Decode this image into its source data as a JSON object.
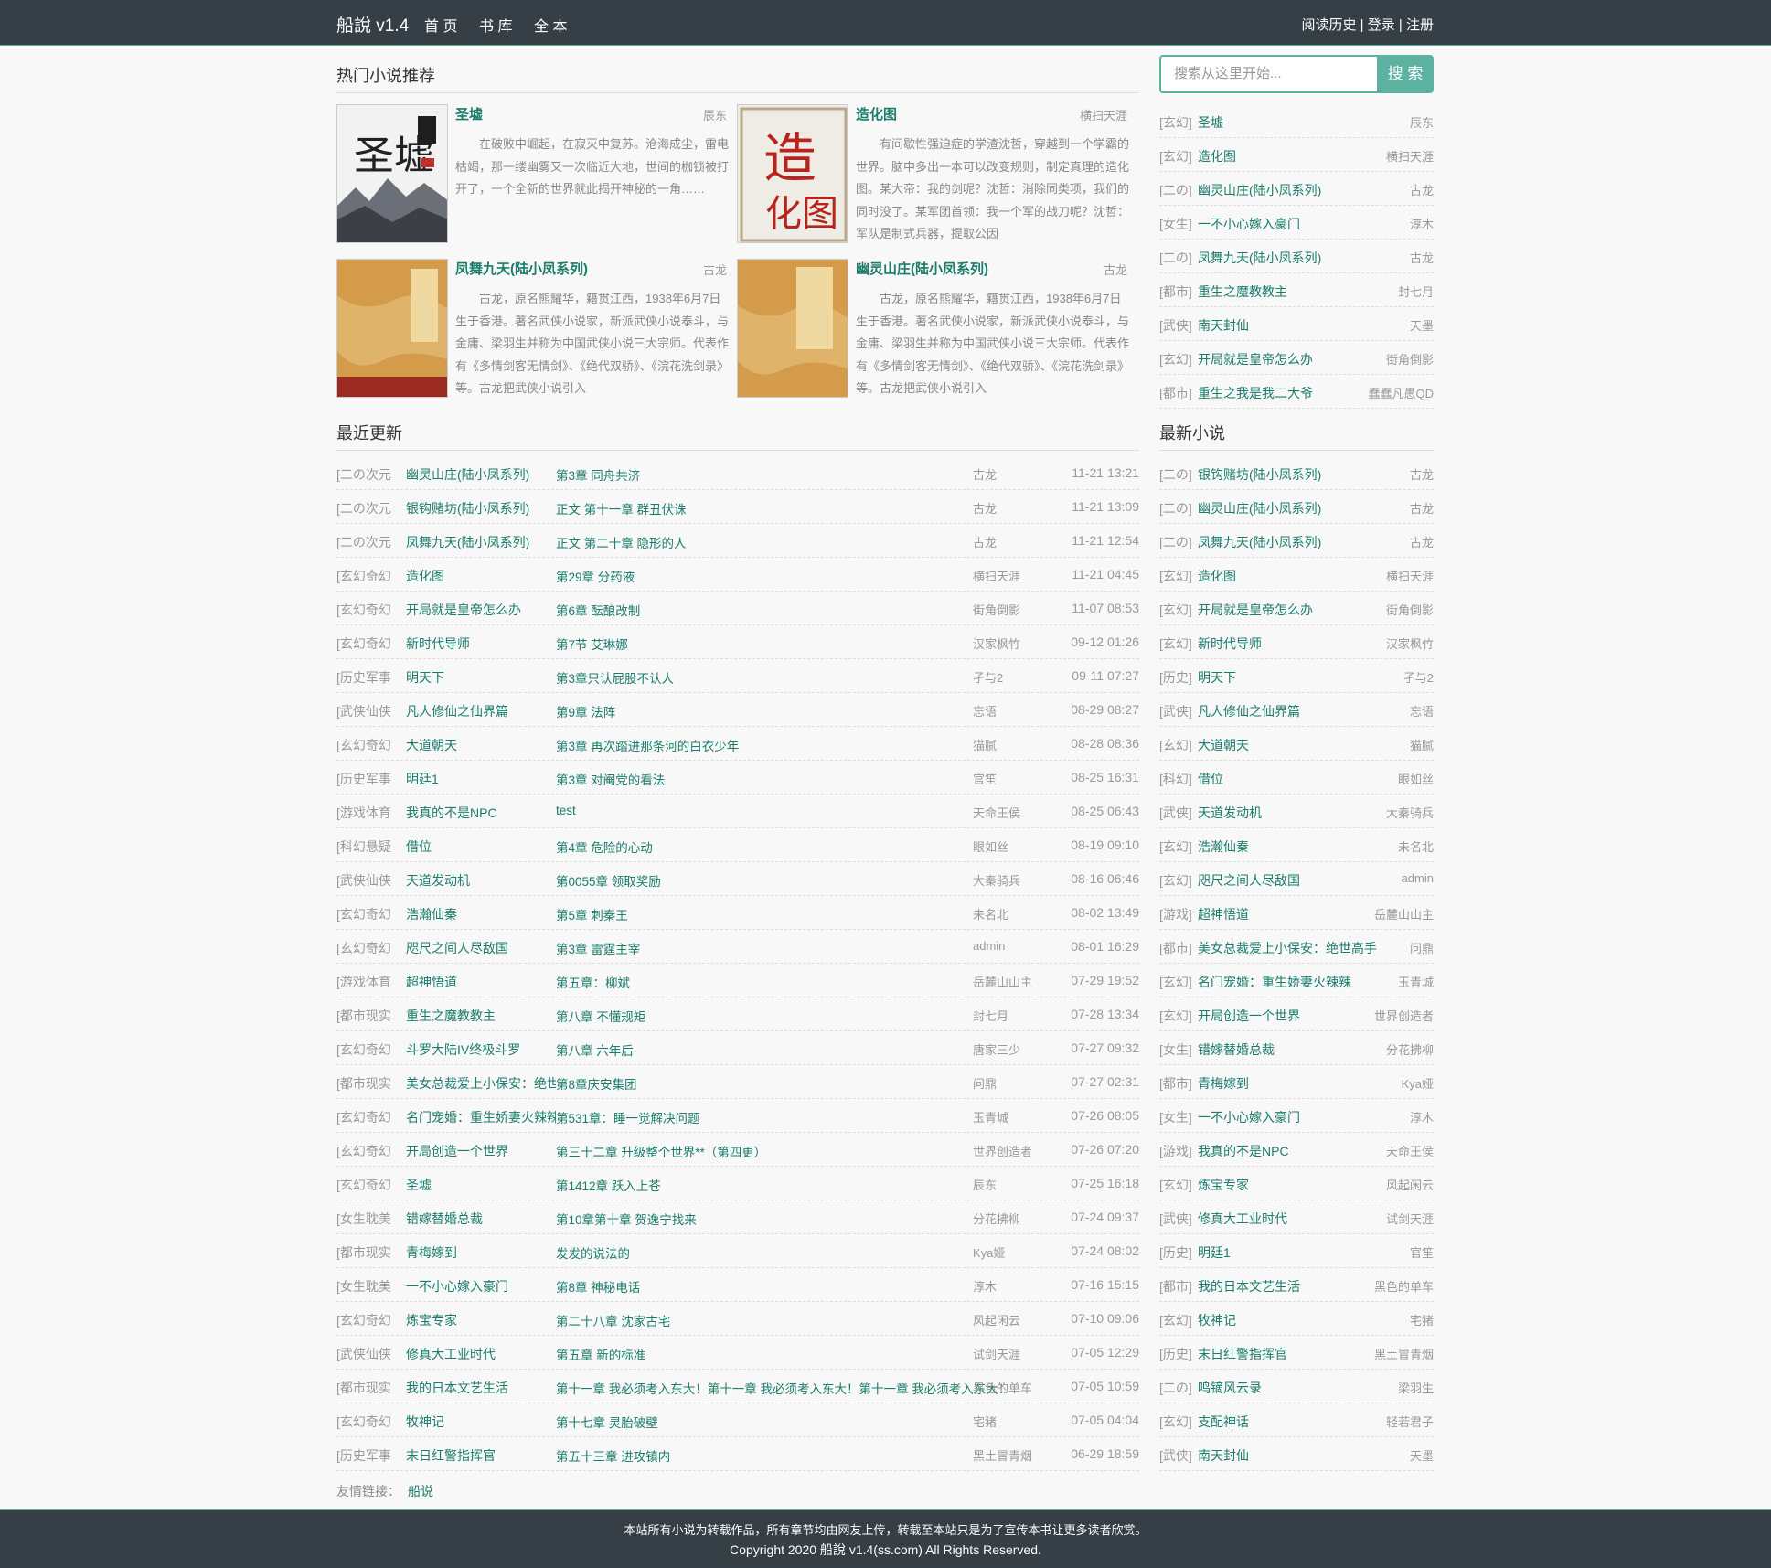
{
  "header": {
    "brand": "船說 v1.4",
    "nav": [
      "首 页",
      "书 库",
      "全 本"
    ],
    "links": [
      "阅读历史",
      "登录",
      "注册"
    ],
    "sep": "|"
  },
  "hot": {
    "title": "热门小说推荐",
    "books": [
      {
        "name": "圣墟",
        "author": "辰东",
        "desc": "在破败中崛起，在寂灭中复苏。沧海成尘，雷电枯竭，那一缕幽雾又一次临近大地，世间的枷锁被打开了，一个全新的世界就此揭开神秘的一角……"
      },
      {
        "name": "造化图",
        "author": "横扫天涯",
        "desc": "有间歇性强迫症的学渣沈哲，穿越到一个学霸的世界。脑中多出一本可以改变规则，制定真理的造化图。某大帝：我的剑呢？沈哲：消除同类项，我们的同时没了。某军团首领：我一个军的战刀呢？沈哲：军队是制式兵器，提取公因"
      },
      {
        "name": "凤舞九天(陆小凤系列)",
        "author": "古龙",
        "desc": "古龙，原名熊耀华，籍贯江西，1938年6月7日生于香港。著名武侠小说家，新派武侠小说泰斗，与金庸、梁羽生并称为中国武侠小说三大宗师。代表作有《多情剑客无情剑》、《绝代双骄》、《浣花洗剑录》等。古龙把武侠小说引入"
      },
      {
        "name": "幽灵山庄(陆小凤系列)",
        "author": "古龙",
        "desc": "古龙，原名熊耀华，籍贯江西，1938年6月7日生于香港。著名武侠小说家，新派武侠小说泰斗，与金庸、梁羽生并称为中国武侠小说三大宗师。代表作有《多情剑客无情剑》、《绝代双骄》、《浣花洗剑录》等。古龙把武侠小说引入"
      }
    ]
  },
  "recent": {
    "title": "最近更新",
    "rows": [
      {
        "cat": "[二の次元",
        "name": "幽灵山庄(陆小凤系列)",
        "chapter": "第3章 同舟共济",
        "author": "古龙",
        "time": "11-21 13:21"
      },
      {
        "cat": "[二の次元",
        "name": "银钩赌坊(陆小凤系列)",
        "chapter": "正文 第十一章 群丑伏诛",
        "author": "古龙",
        "time": "11-21 13:09"
      },
      {
        "cat": "[二の次元",
        "name": "凤舞九天(陆小凤系列)",
        "chapter": "正文 第二十章 隐形的人",
        "author": "古龙",
        "time": "11-21 12:54"
      },
      {
        "cat": "[玄幻奇幻",
        "name": "造化图",
        "chapter": "第29章 分药液",
        "author": "横扫天涯",
        "time": "11-21 04:45"
      },
      {
        "cat": "[玄幻奇幻",
        "name": "开局就是皇帝怎么办",
        "chapter": "第6章 酝酿改制",
        "author": "街角倒影",
        "time": "11-07 08:53"
      },
      {
        "cat": "[玄幻奇幻",
        "name": "新时代导师",
        "chapter": "第7节 艾琳娜",
        "author": "汉家枫竹",
        "time": "09-12 01:26"
      },
      {
        "cat": "[历史军事",
        "name": "明天下",
        "chapter": "第3章只认屁股不认人",
        "author": "孑与2",
        "time": "09-11 07:27"
      },
      {
        "cat": "[武侠仙侠",
        "name": "凡人修仙之仙界篇",
        "chapter": "第9章 法阵",
        "author": "忘语",
        "time": "08-29 08:27"
      },
      {
        "cat": "[玄幻奇幻",
        "name": "大道朝天",
        "chapter": "第3章 再次踏进那条河的白衣少年",
        "author": "猫腻",
        "time": "08-28 08:36"
      },
      {
        "cat": "[历史军事",
        "name": "明廷1",
        "chapter": "第3章 对阉党的看法",
        "author": "官笙",
        "time": "08-25 16:31"
      },
      {
        "cat": "[游戏体育",
        "name": "我真的不是NPC",
        "chapter": "test",
        "author": "天命王侯",
        "time": "08-25 06:43"
      },
      {
        "cat": "[科幻悬疑",
        "name": "借位",
        "chapter": "第4章 危险的心动",
        "author": "眼如丝",
        "time": "08-19 09:10"
      },
      {
        "cat": "[武侠仙侠",
        "name": "天道发动机",
        "chapter": "第0055章 领取奖励",
        "author": "大秦骑兵",
        "time": "08-16 06:46"
      },
      {
        "cat": "[玄幻奇幻",
        "name": "浩瀚仙秦",
        "chapter": "第5章 刺秦王",
        "author": "未名北",
        "time": "08-02 13:49"
      },
      {
        "cat": "[玄幻奇幻",
        "name": "咫尺之间人尽敌国",
        "chapter": "第3章 雷霆主宰",
        "author": "admin",
        "time": "08-01 16:29"
      },
      {
        "cat": "[游戏体育",
        "name": "超神悟道",
        "chapter": "第五章：柳斌",
        "author": "岳麓山山主",
        "time": "07-29 19:52"
      },
      {
        "cat": "[都市现实",
        "name": "重生之魔教教主",
        "chapter": "第八章 不懂规矩",
        "author": "封七月",
        "time": "07-28 13:34"
      },
      {
        "cat": "[玄幻奇幻",
        "name": "斗罗大陆IV终极斗罗",
        "chapter": "第八章 六年后",
        "author": "唐家三少",
        "time": "07-27 09:32"
      },
      {
        "cat": "[都市现实",
        "name": "美女总裁爱上小保安：绝世高手",
        "chapter": "第8章庆安集团",
        "author": "问鼎",
        "time": "07-27 02:31"
      },
      {
        "cat": "[玄幻奇幻",
        "name": "名门宠婚：重生娇妻火辣辣",
        "chapter": "第531章：睡一觉解决问题",
        "author": "玉青城",
        "time": "07-26 08:05"
      },
      {
        "cat": "[玄幻奇幻",
        "name": "开局创造一个世界",
        "chapter": "第三十二章 升级整个世界**（第四更）",
        "author": "世界创造者",
        "time": "07-26 07:20"
      },
      {
        "cat": "[玄幻奇幻",
        "name": "圣墟",
        "chapter": "第1412章 跃入上苍",
        "author": "辰东",
        "time": "07-25 16:18"
      },
      {
        "cat": "[女生耽美",
        "name": "错嫁替婚总裁",
        "chapter": "第10章第十章 贺逸宁找来",
        "author": "分花拂柳",
        "time": "07-24 09:37"
      },
      {
        "cat": "[都市现实",
        "name": "青梅嫁到",
        "chapter": "发发的说法的",
        "author": "Kya娅",
        "time": "07-24 08:02"
      },
      {
        "cat": "[女生耽美",
        "name": "一不小心嫁入豪门",
        "chapter": "第8章 神秘电话",
        "author": "淳木",
        "time": "07-16 15:15"
      },
      {
        "cat": "[玄幻奇幻",
        "name": "炼宝专家",
        "chapter": "第二十八章 沈家古宅",
        "author": "风起闲云",
        "time": "07-10 09:06"
      },
      {
        "cat": "[武侠仙侠",
        "name": "修真大工业时代",
        "chapter": "第五章 新的标准",
        "author": "试剑天涯",
        "time": "07-05 12:29"
      },
      {
        "cat": "[都市现实",
        "name": "我的日本文艺生活",
        "chapter": "第十一章 我必须考入东大！第十一章 我必须考入东大！第十一章 我必须考入东大！",
        "author": "黑色的单车",
        "time": "07-05 10:59"
      },
      {
        "cat": "[玄幻奇幻",
        "name": "牧神记",
        "chapter": "第十七章 灵胎破壁",
        "author": "宅猪",
        "time": "07-05 04:04"
      },
      {
        "cat": "[历史军事",
        "name": "末日红警指挥官",
        "chapter": "第五十三章 进攻镇内",
        "author": "黑土冒青烟",
        "time": "06-29 18:59"
      }
    ]
  },
  "search": {
    "placeholder": "搜索从这里开始...",
    "button": "搜 索"
  },
  "side_hot": [
    {
      "cat": "[玄幻]",
      "name": "圣墟",
      "author": "辰东"
    },
    {
      "cat": "[玄幻]",
      "name": "造化图",
      "author": "横扫天涯"
    },
    {
      "cat": "[二の]",
      "name": "幽灵山庄(陆小凤系列)",
      "author": "古龙"
    },
    {
      "cat": "[女生]",
      "name": "一不小心嫁入豪门",
      "author": "淳木"
    },
    {
      "cat": "[二の]",
      "name": "凤舞九天(陆小凤系列)",
      "author": "古龙"
    },
    {
      "cat": "[都市]",
      "name": "重生之魔教教主",
      "author": "封七月"
    },
    {
      "cat": "[武侠]",
      "name": "南天封仙",
      "author": "天墨"
    },
    {
      "cat": "[玄幻]",
      "name": "开局就是皇帝怎么办",
      "author": "街角倒影"
    },
    {
      "cat": "[都市]",
      "name": "重生之我是我二大爷",
      "author": "蠢蠢凡愚QD"
    }
  ],
  "newest": {
    "title": "最新小说",
    "rows": [
      {
        "cat": "[二の]",
        "name": "银钩赌坊(陆小凤系列)",
        "author": "古龙"
      },
      {
        "cat": "[二の]",
        "name": "幽灵山庄(陆小凤系列)",
        "author": "古龙"
      },
      {
        "cat": "[二の]",
        "name": "凤舞九天(陆小凤系列)",
        "author": "古龙"
      },
      {
        "cat": "[玄幻]",
        "name": "造化图",
        "author": "横扫天涯"
      },
      {
        "cat": "[玄幻]",
        "name": "开局就是皇帝怎么办",
        "author": "街角倒影"
      },
      {
        "cat": "[玄幻]",
        "name": "新时代导师",
        "author": "汉家枫竹"
      },
      {
        "cat": "[历史]",
        "name": "明天下",
        "author": "孑与2"
      },
      {
        "cat": "[武侠]",
        "name": "凡人修仙之仙界篇",
        "author": "忘语"
      },
      {
        "cat": "[玄幻]",
        "name": "大道朝天",
        "author": "猫腻"
      },
      {
        "cat": "[科幻]",
        "name": "借位",
        "author": "眼如丝"
      },
      {
        "cat": "[武侠]",
        "name": "天道发动机",
        "author": "大秦骑兵"
      },
      {
        "cat": "[玄幻]",
        "name": "浩瀚仙秦",
        "author": "未名北"
      },
      {
        "cat": "[玄幻]",
        "name": "咫尺之间人尽敌国",
        "author": "admin"
      },
      {
        "cat": "[游戏]",
        "name": "超神悟道",
        "author": "岳麓山山主"
      },
      {
        "cat": "[都市]",
        "name": "美女总裁爱上小保安：绝世高手",
        "author": "问鼎"
      },
      {
        "cat": "[玄幻]",
        "name": "名门宠婚：重生娇妻火辣辣",
        "author": "玉青城"
      },
      {
        "cat": "[玄幻]",
        "name": "开局创造一个世界",
        "author": "世界创造者"
      },
      {
        "cat": "[女生]",
        "name": "错嫁替婚总裁",
        "author": "分花拂柳"
      },
      {
        "cat": "[都市]",
        "name": "青梅嫁到",
        "author": "Kya娅"
      },
      {
        "cat": "[女生]",
        "name": "一不小心嫁入豪门",
        "author": "淳木"
      },
      {
        "cat": "[游戏]",
        "name": "我真的不是NPC",
        "author": "天命王侯"
      },
      {
        "cat": "[玄幻]",
        "name": "炼宝专家",
        "author": "风起闲云"
      },
      {
        "cat": "[武侠]",
        "name": "修真大工业时代",
        "author": "试剑天涯"
      },
      {
        "cat": "[历史]",
        "name": "明廷1",
        "author": "官笙"
      },
      {
        "cat": "[都市]",
        "name": "我的日本文艺生活",
        "author": "黑色的单车"
      },
      {
        "cat": "[玄幻]",
        "name": "牧神记",
        "author": "宅猪"
      },
      {
        "cat": "[历史]",
        "name": "末日红警指挥官",
        "author": "黑土冒青烟"
      },
      {
        "cat": "[二の]",
        "name": "鸣镝风云录",
        "author": "梁羽生"
      },
      {
        "cat": "[玄幻]",
        "name": "支配神话",
        "author": "轻若君子"
      },
      {
        "cat": "[武侠]",
        "name": "南天封仙",
        "author": "天墨"
      }
    ]
  },
  "friends": {
    "label": "友情链接：",
    "link": "船说"
  },
  "footer": {
    "line1": "本站所有小说为转载作品，所有章节均由网友上传，转载至本站只是为了宣传本书让更多读者欣赏。",
    "line2": "Copyright 2020 船說 v1.4(ss.com) All Rights Reserved."
  },
  "colors": {
    "accent": "#5db1a1",
    "link": "#1a7c6a",
    "bar": "#363f45"
  }
}
